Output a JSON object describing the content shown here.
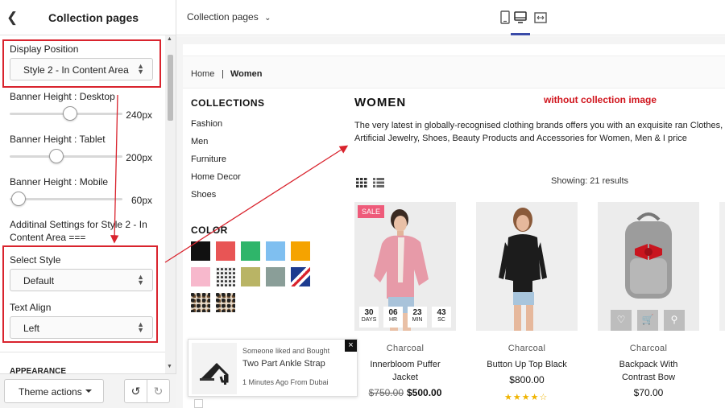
{
  "editor": {
    "back_label": "‹",
    "title": "Collection pages",
    "display_position_label": "Display Position",
    "display_position_value": "Style 2 - In Content Area",
    "banner_desktop_label": "Banner Height : Desktop",
    "banner_desktop_value": "240px",
    "banner_desktop_fraction": 0.54,
    "banner_tablet_label": "Banner Height : Tablet",
    "banner_tablet_value": "200px",
    "banner_tablet_fraction": 0.4,
    "banner_mobile_label": "Banner Height : Mobile",
    "banner_mobile_value": "60px",
    "banner_mobile_fraction": 0.02,
    "additional_label_1": "Additinal Settings for Style 2 - In",
    "additional_label_2": "Content Area ===",
    "select_style_label": "Select Style",
    "select_style_value": "Default",
    "text_align_label": "Text Align",
    "text_align_value": "Left",
    "appearance_label": "APPEARANCE",
    "theme_actions_label": "Theme actions",
    "undo_icon": "undo-icon",
    "redo_icon": "redo-icon",
    "highlight_color": "#d9232d"
  },
  "topbar": {
    "page_select": "Collection pages",
    "devices": [
      "mobile-icon",
      "desktop-icon",
      "fullwidth-icon"
    ],
    "active_device": "desktop-icon",
    "accent_color": "#3a4ba8"
  },
  "store": {
    "breadcrumb": {
      "home": "Home",
      "separator": "|",
      "current": "Women"
    },
    "collections_heading": "COLLECTIONS",
    "collections": [
      "Fashion",
      "Men",
      "Furniture",
      "Home Decor",
      "Shoes"
    ],
    "color_heading": "COLOR",
    "swatches": [
      "#111111",
      "#e85555",
      "#2fb56a",
      "#7fbff0",
      "#f5a300",
      "#f7b8cc",
      "pattern-dots",
      "#b9b465",
      "#8a9e98",
      "pattern-flag",
      "pattern-leopard",
      "pattern-leopard-2"
    ],
    "title": "WOMEN",
    "note": "without collection image",
    "description": "The very latest in globally-recognised clothing brands offers you with an exquisite ran Clothes, Artificial Jewelry, Shoes, Beauty Products and Accessories for Women, Men & I price",
    "showing": "Showing: 21 results",
    "products": [
      {
        "brand": "Charcoal",
        "name_1": "Innerbloom Puffer",
        "name_2": "Jacket",
        "old_price": "$750.00",
        "price": "$500.00",
        "sale": "SALE",
        "countdown": [
          {
            "n": "30",
            "l": "DAYS"
          },
          {
            "n": "06",
            "l": "HR"
          },
          {
            "n": "23",
            "l": "MIN"
          },
          {
            "n": "43",
            "l": "SC"
          }
        ]
      },
      {
        "brand": "Charcoal",
        "name_1": "Button Up Top Black",
        "name_2": "",
        "old_price": "",
        "price": "$800.00",
        "rating": 4
      },
      {
        "brand": "Charcoal",
        "name_1": "Backpack With",
        "name_2": "Contrast Bow",
        "old_price": "",
        "price": "$70.00"
      }
    ],
    "popup": {
      "line1": "Someone liked and Bought",
      "product": "Two Part Ankle Strap",
      "line3": "1 Minutes Ago From Dubai",
      "close": "×"
    }
  }
}
